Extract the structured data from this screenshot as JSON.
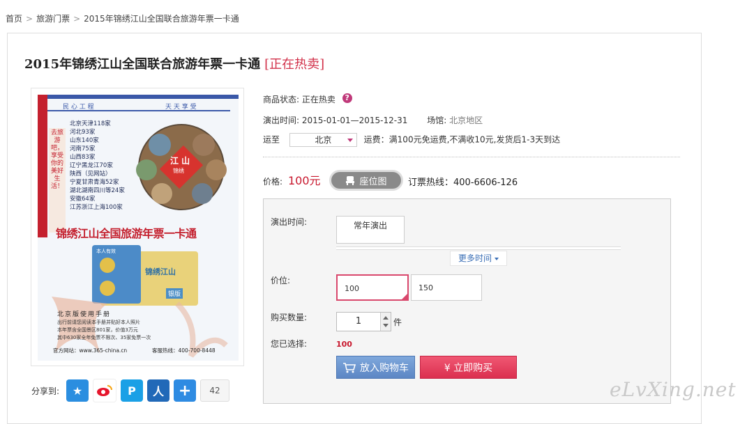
{
  "breadcrumb": {
    "items": [
      "首页",
      "旅游门票",
      "2015年锦绣江山全国联合旅游年票一卡通"
    ],
    "separator": ">"
  },
  "product": {
    "title": "2015年锦绣江山全国联合旅游年票一卡通",
    "hot_tag": "[正在热卖]"
  },
  "poster": {
    "top_left": "民 心 工 程",
    "top_right": "天 天 享 受",
    "side_text": "去旅游吧，享受你的美好生活！",
    "regions": [
      "北京天津118家",
      "河北93家",
      "山东140家",
      "河南75家",
      "山西83家",
      "辽宁黑龙江70家",
      "陕西（见网站）",
      "宁夏甘肃青海52家",
      "湖北湖南四川等24家",
      "安徽64家",
      "江苏浙江上海100家"
    ],
    "seal_text": "江 山",
    "seal_sub": "锦绣",
    "headline": "锦绣江山全国旅游年票一卡通",
    "card_label": "本人有效",
    "card_brand": "锦绣江山",
    "card_tier": "银版",
    "manual_title": "北京版使用手册",
    "manual_lines": [
      "出行前请您阅读本手册并贴好本人照片",
      "本年票含全国景区801家，价值3万元",
      "其中630家全年免票不限次、35家免票一次"
    ],
    "website": "官方网站：www.365-china.cn",
    "service_phone": "客服热线：400-700-8448"
  },
  "share": {
    "label": "分享到:",
    "count": "42"
  },
  "info": {
    "status_label": "商品状态:",
    "status_value": "正在热卖",
    "time_label": "演出时间:",
    "time_value": "2015-01-01—2015-12-31",
    "venue_label": "场馆:",
    "venue_value": "北京地区",
    "ship_label": "运至",
    "ship_city": "北京",
    "ship_note": "运费：满100元免运费,不满收10元,发货后1-3天到达"
  },
  "price": {
    "label": "价格:",
    "value": "100元",
    "seat_button": "座位图",
    "hotline": "订票热线：400-6606-126"
  },
  "options": {
    "time_label": "演出时间:",
    "time_option": "常年演出",
    "more_time": "更多时间",
    "price_label": "价位:",
    "price_options": [
      "100",
      "150"
    ],
    "qty_label": "购买数量:",
    "qty_value": "1",
    "qty_unit": "件",
    "chosen_label": "您已选择:",
    "chosen_value": "100",
    "cart_button": "放入购物车",
    "buy_button": "¥ 立即购买"
  },
  "watermark": "eLvXing.net",
  "colors": {
    "accent": "#d2314a",
    "price": "#c8182e",
    "link": "#3b6fb6"
  }
}
